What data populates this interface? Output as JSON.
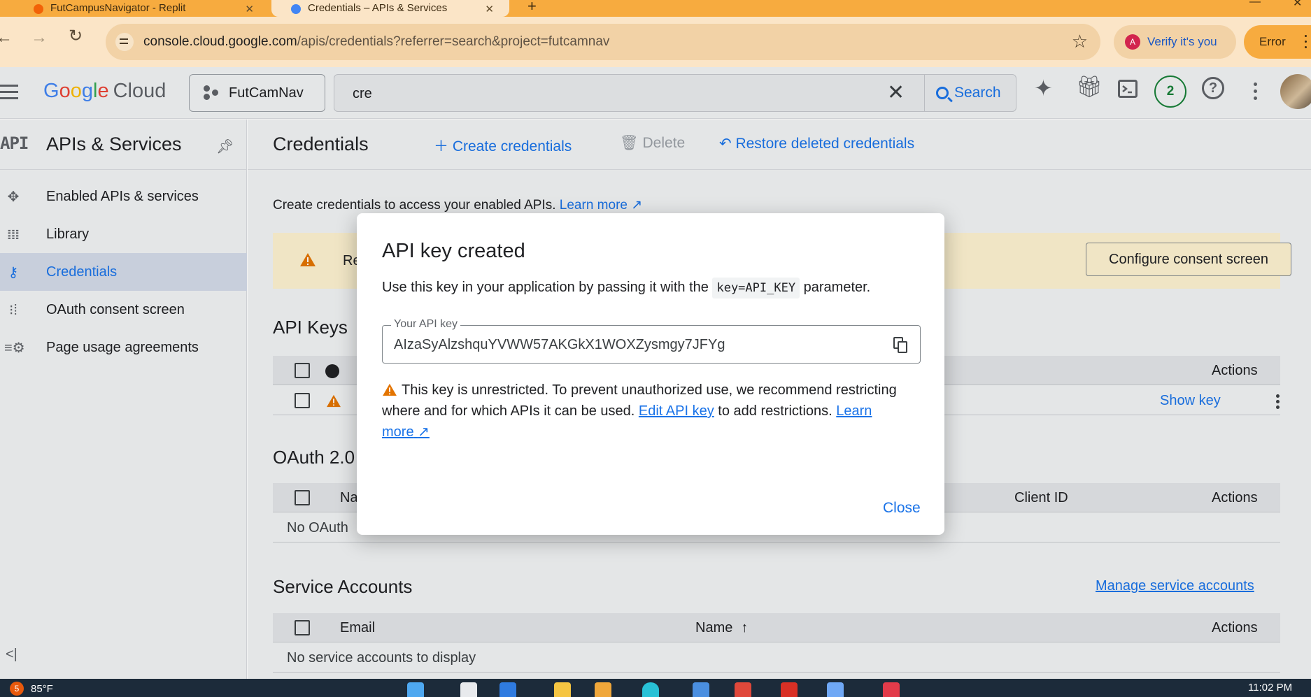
{
  "browser": {
    "tabs": [
      {
        "title": "FutCampusNavigator - Replit",
        "active": false
      },
      {
        "title": "Credentials – APIs & Services",
        "active": true
      }
    ],
    "url_host": "console.cloud.google.com",
    "url_path": "/apis/credentials?referrer=search&project=futcamnav",
    "verify_label": "Verify it's you",
    "verify_avatar": "A",
    "error_label": "Error"
  },
  "header": {
    "logo_word": "Google",
    "logo_product": "Cloud",
    "project": "FutCamNav",
    "search_value": "cre",
    "search_button": "Search",
    "notification_count": "2",
    "help_glyph": "?"
  },
  "sidebar": {
    "api_badge": "API",
    "title": "APIs & Services",
    "items": [
      {
        "label": "Enabled APIs & services",
        "icon": "enabled-apis-icon"
      },
      {
        "label": "Library",
        "icon": "library-icon"
      },
      {
        "label": "Credentials",
        "icon": "key-icon",
        "active": true
      },
      {
        "label": "OAuth consent screen",
        "icon": "consent-icon"
      },
      {
        "label": "Page usage agreements",
        "icon": "agreements-icon"
      }
    ]
  },
  "main": {
    "title": "Credentials",
    "create_label": "Create credentials",
    "delete_label": "Delete",
    "restore_label": "Restore deleted credentials",
    "intro_text": "Create credentials to access your enabled APIs.",
    "intro_link": "Learn more",
    "banner_text": "Re",
    "configure_button": "Configure consent screen",
    "api_keys": {
      "title": "API Keys",
      "actions_header": "Actions",
      "show_key": "Show key"
    },
    "oauth": {
      "title": "OAuth 2.0",
      "name_header": "Na",
      "client_id_header": "Client ID",
      "actions_header": "Actions",
      "empty_text": "No OAuth"
    },
    "service_accounts": {
      "title": "Service Accounts",
      "manage_link": "Manage service accounts",
      "email_header": "Email",
      "name_header": "Name",
      "actions_header": "Actions",
      "empty_text": "No service accounts to display"
    }
  },
  "dialog": {
    "title": "API key created",
    "desc_before": "Use this key in your application by passing it with the",
    "desc_code": "key=API_KEY",
    "desc_after": "parameter.",
    "key_label": "Your API key",
    "key_value": "AIzaSyAlzshquYVWW57AKGkX1WOXZysmgy7JFYg",
    "warn_text": "This key is unrestricted. To prevent unauthorized use, we recommend restricting where and for which APIs it can be used.",
    "warn_link": "Edit API key",
    "warn_after": "to add restrictions.",
    "learn_more": "Learn more",
    "close_label": "Close"
  },
  "taskbar": {
    "weather_badge": "5",
    "temperature": "85°F",
    "time": "11:02 PM"
  },
  "colors": {
    "accent": "#1a73e8",
    "warning": "#e37400",
    "browser_frame": "#f7ab3f"
  }
}
